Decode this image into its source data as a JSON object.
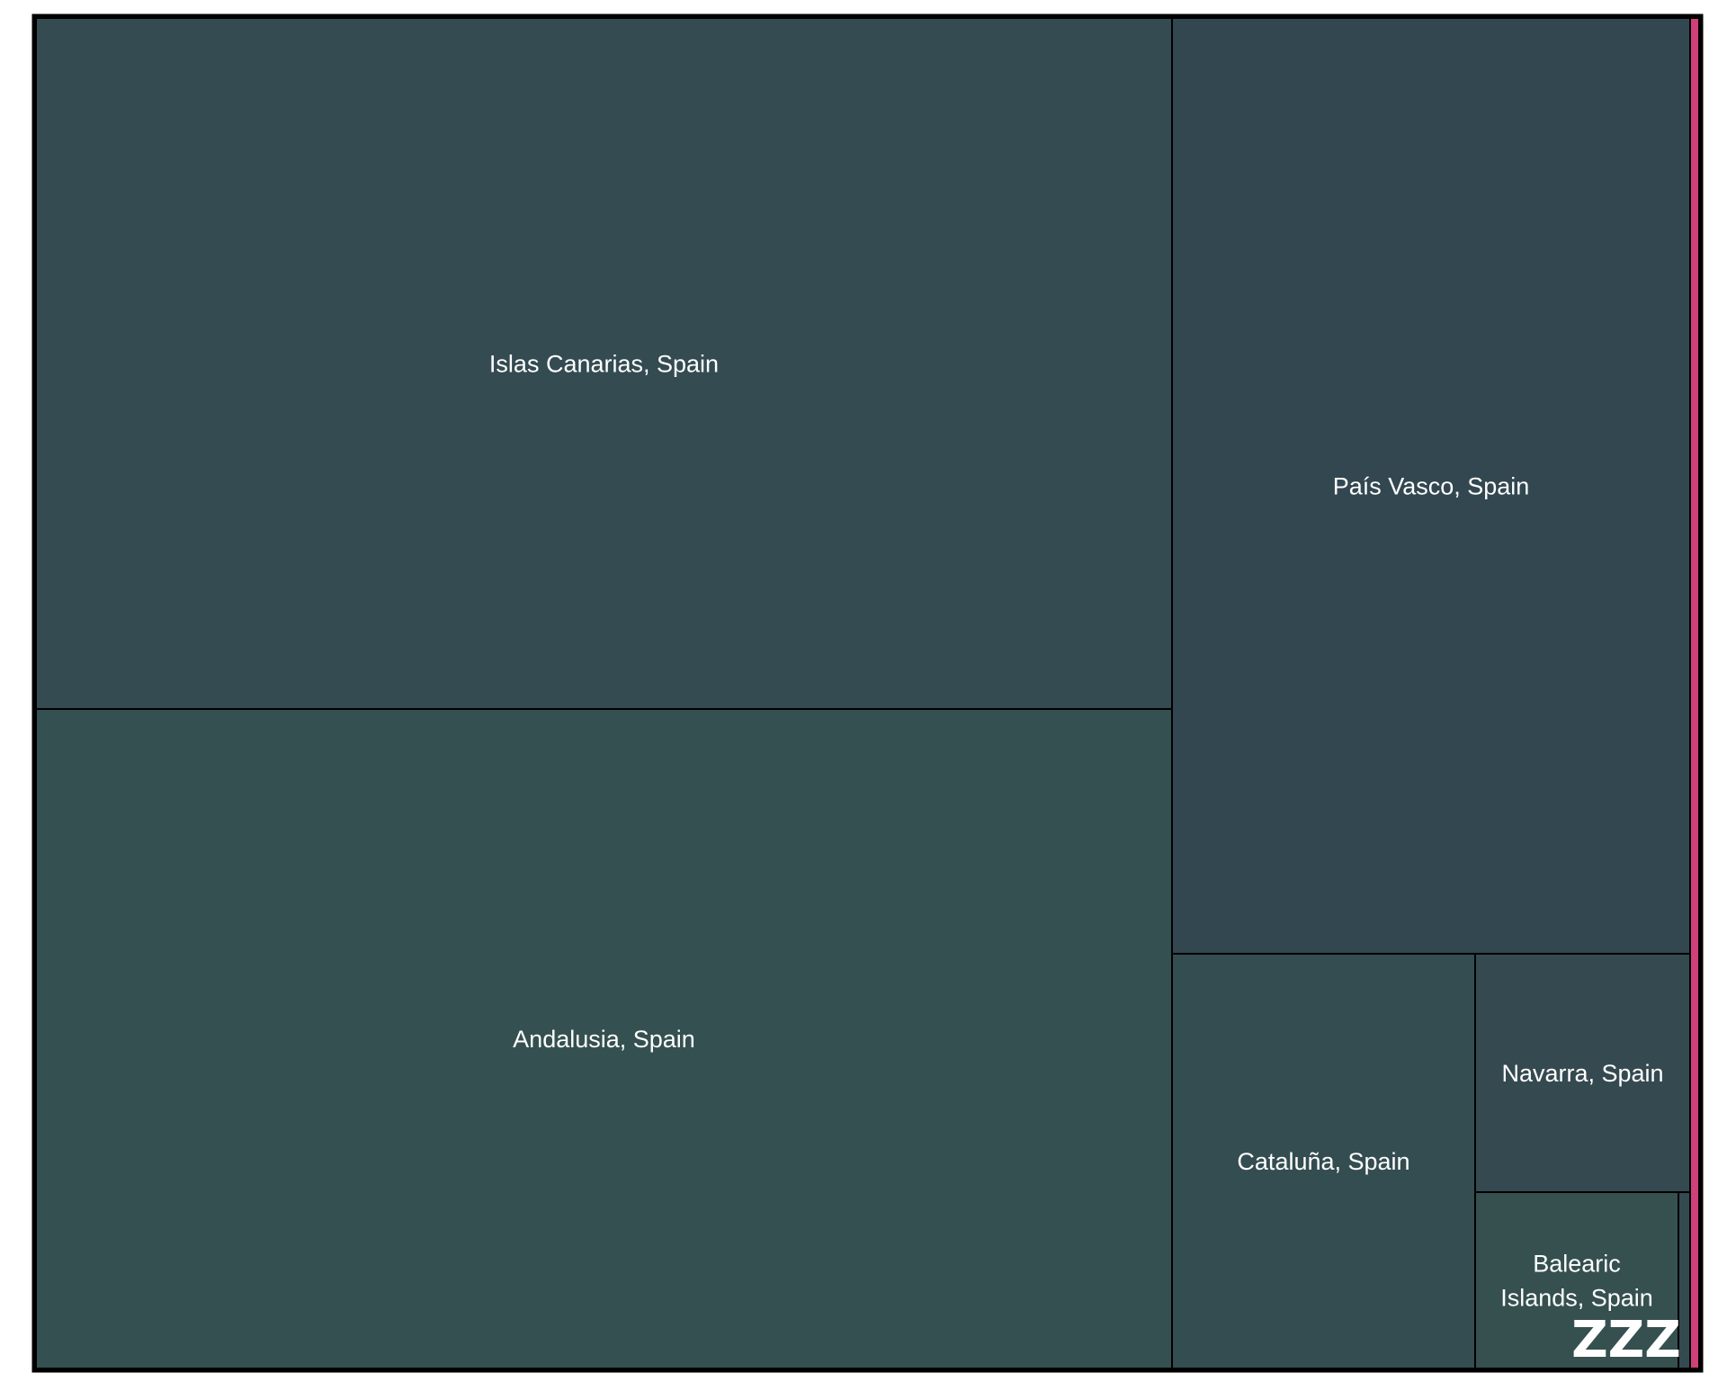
{
  "chart_data": {
    "type": "treemap",
    "title": "",
    "items": [
      {
        "label": "Islas Canarias, Spain",
        "value": 28.3,
        "color": "#344b52"
      },
      {
        "label": "Andalusia, Spain",
        "value": 27.0,
        "color": "#355051"
      },
      {
        "label": "País Vasco, Spain",
        "value": 17.5,
        "color": "#334750"
      },
      {
        "label": "Cataluña, Spain",
        "value": 9.2,
        "color": "#344d51"
      },
      {
        "label": "Navarra, Spain",
        "value": 3.8,
        "color": "#354a50"
      },
      {
        "label": "Balearic Islands, Spain",
        "value": 3.2,
        "color": "#365050"
      },
      {
        "label": "",
        "value": 0.06,
        "color": "#354a50"
      },
      {
        "label": "",
        "value": 0.4,
        "color": "#d0407a"
      }
    ]
  },
  "watermark": "ZZZ"
}
